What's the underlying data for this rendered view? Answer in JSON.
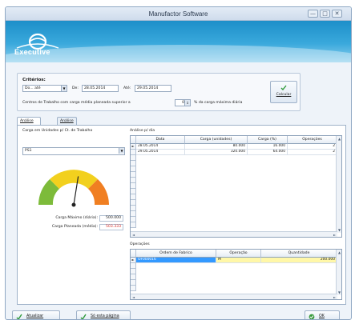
{
  "window": {
    "title": "Manufactor Software",
    "min_glyph": "—",
    "max_glyph": "□",
    "close_glyph": "✕"
  },
  "brand": {
    "logo_text": "Executive",
    "color": "#1d8fc9"
  },
  "criteria": {
    "legend": "Critérios:",
    "period": "Do... até",
    "from_label": "De:",
    "from_date": "28.05.2014",
    "to_label": "Até:",
    "to_date": "29.05.2014",
    "threshold_label": "Centros de Trabalho com carga média planeada superior a",
    "threshold_value": "0",
    "threshold_suffix": "% da carga máxima diária",
    "calc_label": "Calcular"
  },
  "tabs": [
    {
      "label": "Análise Individual"
    },
    {
      "label": "Análise Global"
    }
  ],
  "left": {
    "title": "Carga em Unidades p/ Ct. de Trabalho",
    "work_center": "PS1",
    "gauge_value_fraction": 0.55,
    "max_label": "Carga Máximo (diária):",
    "max_value": "500.000",
    "planned_label": "Carga Planeada (média):",
    "planned_value": "503.333"
  },
  "daily": {
    "title": "Análise p/ dia",
    "columns": [
      "Data",
      "Carga (unidades)",
      "Carga (%)",
      "Operações"
    ],
    "rows": [
      {
        "marker": "►",
        "date": "28.05.2014",
        "load": "80.000",
        "pct": "16.000",
        "ops": "2"
      },
      {
        "marker": "",
        "date": "29.05.2014",
        "load": "320.000",
        "pct": "64.000",
        "ops": "2"
      }
    ]
  },
  "ops": {
    "title": "Operações",
    "columns": [
      "Ordem de Fabrico",
      "Operação",
      "Quantidade"
    ],
    "rows": [
      {
        "marker": "►",
        "order": "OF000016",
        "op": "M",
        "qty": "200.000"
      }
    ]
  },
  "footer": {
    "update_label": "Atualizar",
    "print_label": "Só esta página",
    "ok_label": "OK"
  },
  "colors": {
    "accent": "#1d8fc9",
    "selection": "#3399ff",
    "highlight": "#fff7a8",
    "alert": "#d9302b"
  }
}
